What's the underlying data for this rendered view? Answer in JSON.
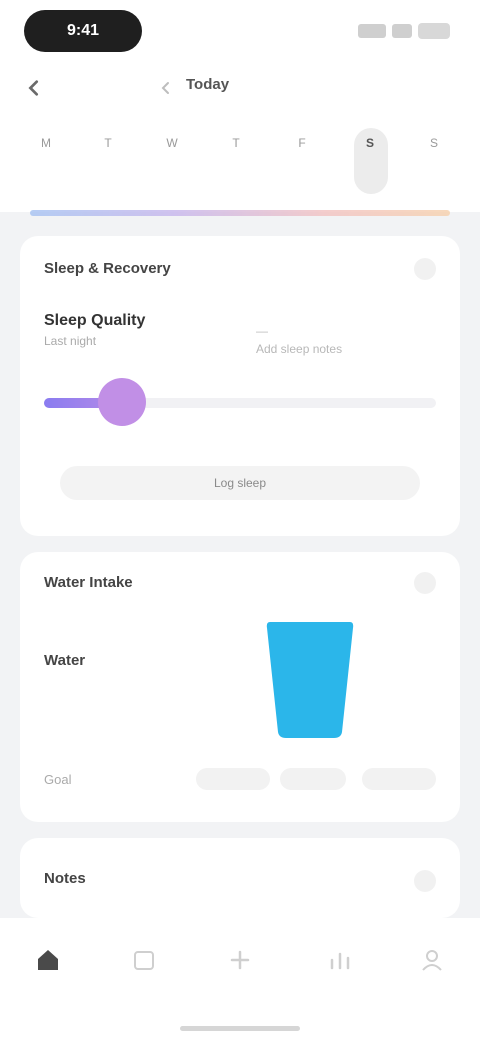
{
  "status": {
    "time": "9:41"
  },
  "header": {
    "title": "Today"
  },
  "days": [
    {
      "name": "M",
      "num": ""
    },
    {
      "name": "T",
      "num": ""
    },
    {
      "name": "W",
      "num": ""
    },
    {
      "name": "T",
      "num": ""
    },
    {
      "name": "F",
      "num": ""
    },
    {
      "name": "S",
      "num": "",
      "selected": true
    },
    {
      "name": "S",
      "num": ""
    }
  ],
  "sleep_card": {
    "title": "Sleep & Recovery",
    "label": "Sleep Quality",
    "sub": "Last night",
    "right_top": "—",
    "right_bottom": "Add sleep notes",
    "slider_value": 0.2,
    "action": "Log sleep"
  },
  "water_card": {
    "title": "Water Intake",
    "label": "Water",
    "sub": "",
    "goal": "Goal",
    "options": [
      "",
      "",
      ""
    ],
    "cup_fill": 1.0,
    "cup_color": "#2bb6ea"
  },
  "third_card": {
    "title": "Notes"
  },
  "nav": [
    {
      "icon": "home-icon",
      "label": "",
      "active": true
    },
    {
      "icon": "calendar-icon",
      "label": ""
    },
    {
      "icon": "plus-icon",
      "label": ""
    },
    {
      "icon": "chart-icon",
      "label": ""
    },
    {
      "icon": "profile-icon",
      "label": ""
    }
  ]
}
